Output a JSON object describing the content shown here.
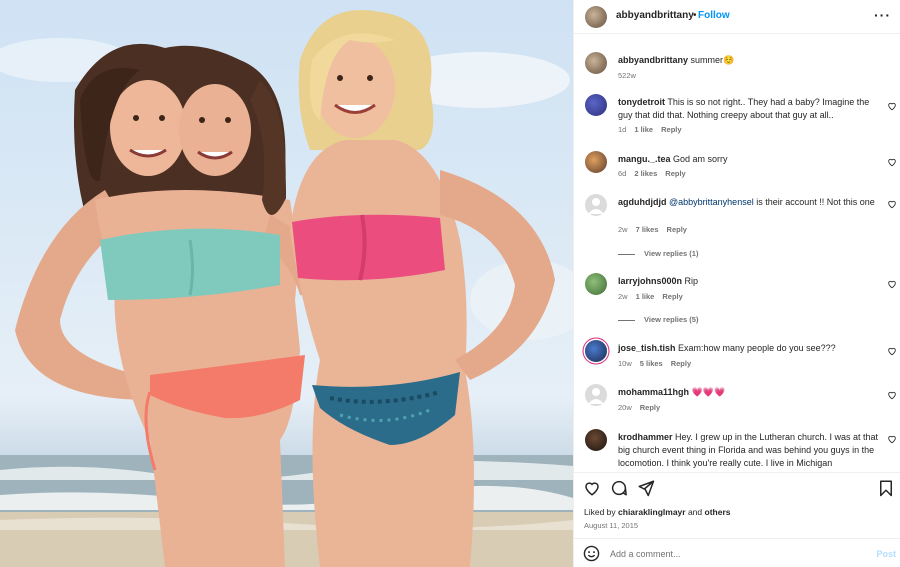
{
  "post": {
    "image_description": "",
    "author": "abbyandbrittany",
    "follow_label": "Follow",
    "separator": "•",
    "more_icon": "more-horizontal-icon"
  },
  "caption": {
    "username": "abbyandbrittany",
    "text": "summer☺️",
    "age": "522w"
  },
  "comments": [
    {
      "username": "tonydetroit",
      "text": "This is so not right.. They had a baby? Imagine the guy that did that. Nothing creepy about that guy at all..",
      "age": "1d",
      "likes": "1 like",
      "reply": "Reply"
    },
    {
      "username": "mangu._.tea",
      "text": "God am sorry",
      "age": "6d",
      "likes": "2 likes",
      "reply": "Reply"
    },
    {
      "username": "agduhdjdjd",
      "mention": "@abbybrittanyhensel",
      "text": " is their account !! Not this one",
      "age": "2w",
      "likes": "7 likes",
      "reply": "Reply",
      "view_replies": "View replies (1)"
    },
    {
      "username": "larryjohns000n",
      "text": "Rip",
      "age": "2w",
      "likes": "1 like",
      "reply": "Reply",
      "view_replies": "View replies (5)"
    },
    {
      "username": "jose_tish.tish",
      "text": "Exam:how many people do you see???",
      "age": "10w",
      "likes": "5 likes",
      "reply": "Reply"
    },
    {
      "username": "mohamma11hgh",
      "text": "💗💗💗",
      "age": "20w",
      "likes": "",
      "reply": "Reply"
    },
    {
      "username": "krodhammer",
      "text": "Hey. I grew up in the Lutheran church. I was at that big church event thing in Florida and was behind you guys in the locomotion. I think you're really cute. I live in Michigan",
      "age": "",
      "likes": "",
      "reply": ""
    }
  ],
  "actions": {
    "like_icon": "heart-icon",
    "comment_icon": "comment-icon",
    "share_icon": "send-icon",
    "save_icon": "bookmark-icon",
    "liked_by_prefix": "Liked by ",
    "liked_by_user": "chiaraklinglmayr",
    "liked_by_suffix": " and ",
    "liked_by_others": "others",
    "date": "August 11, 2015"
  },
  "composer": {
    "emoji_icon": "emoji-icon",
    "placeholder": "Add a comment...",
    "post_label": "Post"
  },
  "colors": {
    "accent": "#0095f6",
    "post_disabled": "#b2dffc",
    "muted": "#737373",
    "text": "#262626"
  }
}
